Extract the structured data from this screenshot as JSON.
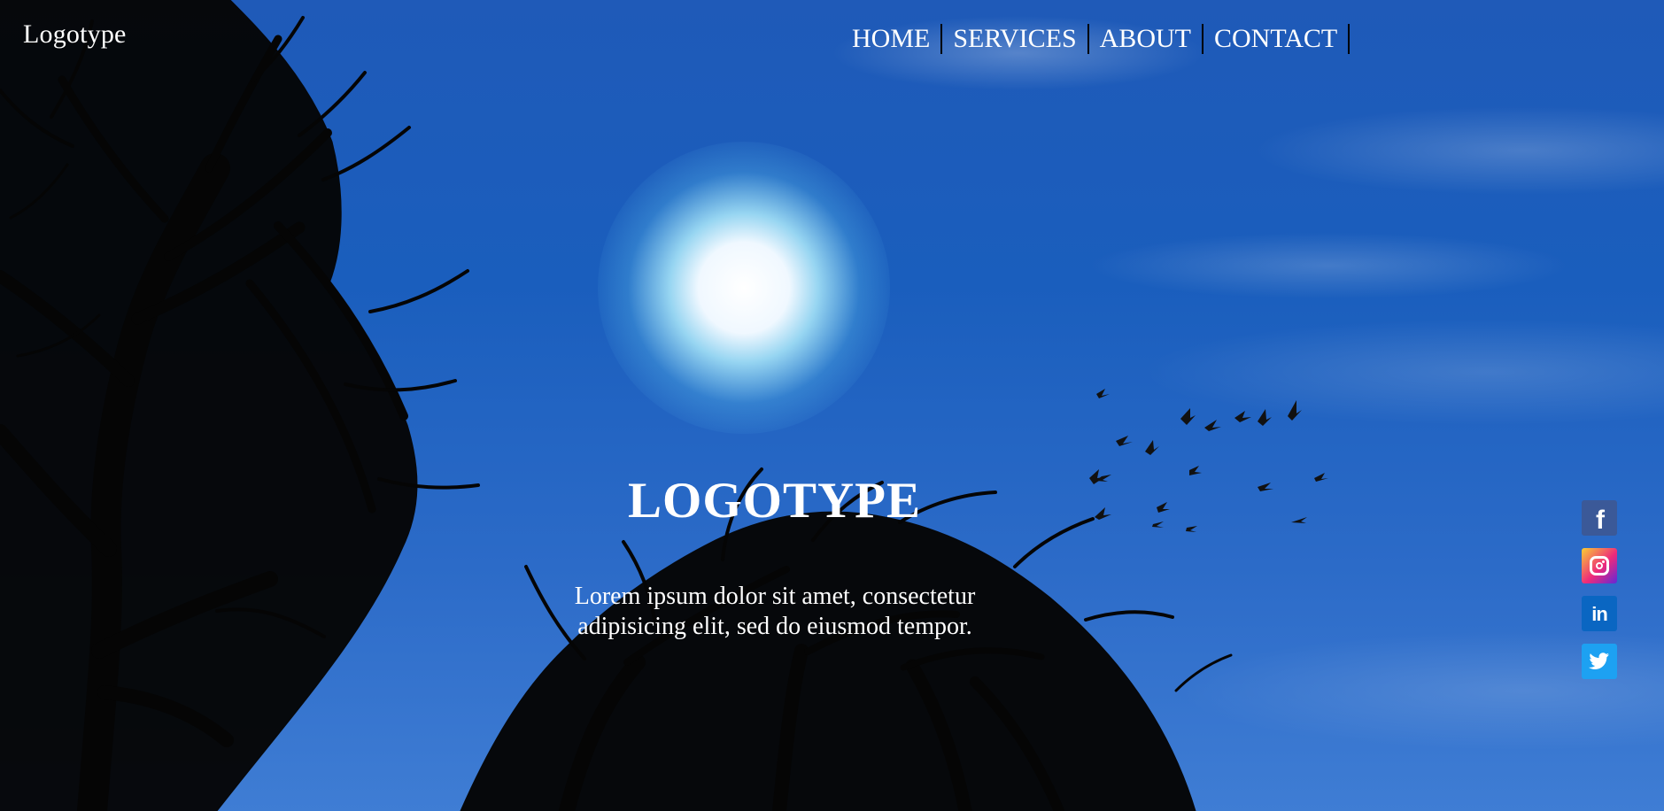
{
  "header": {
    "logo": "Logotype"
  },
  "nav": {
    "items": [
      {
        "label": "HOME"
      },
      {
        "label": "SERVICES"
      },
      {
        "label": "ABOUT"
      },
      {
        "label": "CONTACT"
      }
    ]
  },
  "hero": {
    "title": "LOGOTYPE",
    "text": "Lorem ipsum dolor sit amet, consectetur adipisicing elit, sed do eiusmod tempor."
  },
  "social": {
    "items": [
      {
        "icon": "facebook-icon"
      },
      {
        "icon": "instagram-icon"
      },
      {
        "icon": "linkedin-icon"
      },
      {
        "icon": "twitter-icon"
      }
    ]
  },
  "colors": {
    "sky_top": "#1f5ab8",
    "sky_bottom": "#3f7dd4",
    "text": "#ffffff",
    "facebook": "#3b5998",
    "linkedin": "#0a66c2",
    "twitter": "#1da1f2"
  }
}
